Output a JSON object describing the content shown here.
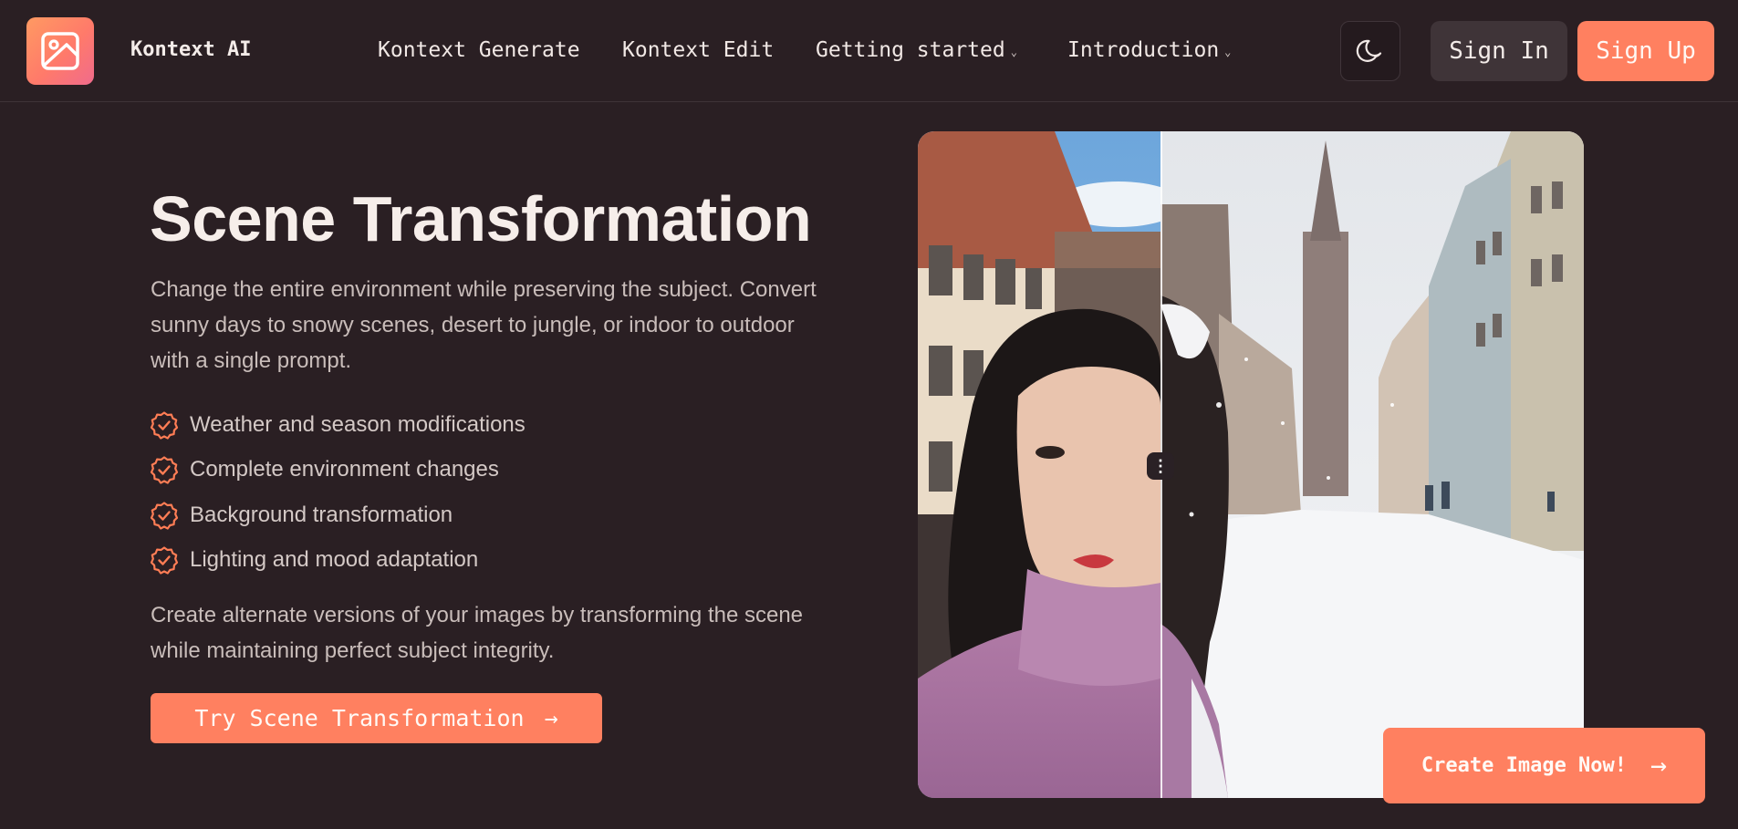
{
  "header": {
    "brand": "Kontext AI",
    "logo_icon": "image-icon",
    "nav": [
      {
        "label": "Kontext Generate",
        "has_dropdown": false
      },
      {
        "label": "Kontext Edit",
        "has_dropdown": false
      },
      {
        "label": "Getting started",
        "has_dropdown": true
      },
      {
        "label": "Introduction",
        "has_dropdown": true
      }
    ],
    "dropdown_glyph": "⌄",
    "theme_toggle_icon": "moon-icon",
    "sign_in": "Sign In",
    "sign_up": "Sign Up"
  },
  "hero": {
    "title": "Scene Transformation",
    "description": "Change the entire environment while preserving the subject. Convert sunny days to snowy scenes, desert to jungle, or indoor to outdoor with a single prompt.",
    "features": [
      "Weather and season modifications",
      "Complete environment changes",
      "Background transformation",
      "Lighting and mood adaptation"
    ],
    "feature_icon": "check-badge-icon",
    "closing": "Create alternate versions of your images by transforming the scene while maintaining perfect subject integrity.",
    "cta": "Try Scene Transformation",
    "cta_arrow": "→"
  },
  "comparison": {
    "before_label": "",
    "after_label": "",
    "handle_glyph": "⋮"
  },
  "floating": {
    "create": "Create Image Now!",
    "arrow": "→"
  },
  "colors": {
    "background": "#2a1f23",
    "accent": "#ff8060",
    "text": "#f2e9e6",
    "muted": "#c9bdba"
  }
}
